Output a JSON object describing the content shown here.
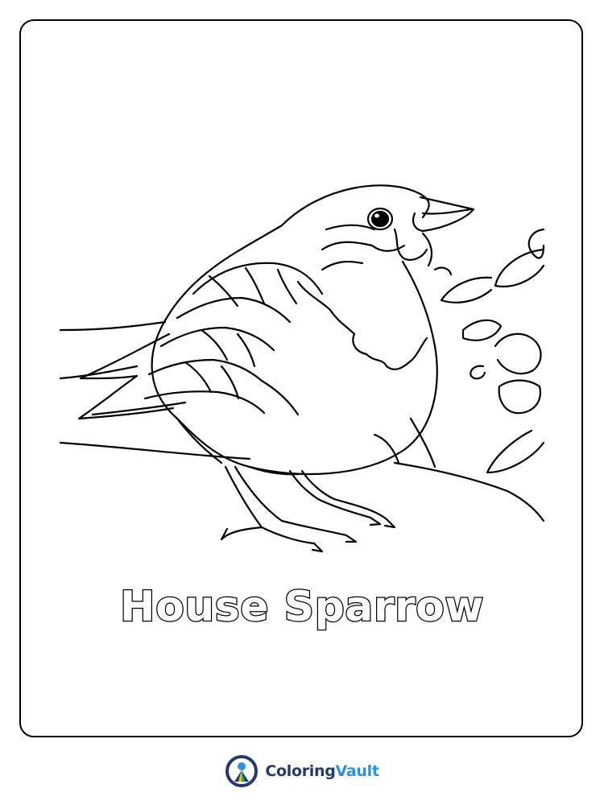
{
  "page": {
    "title": "House Sparrow",
    "subject": "house-sparrow"
  },
  "brand": {
    "name_part1": "Coloring",
    "name_part2": "Vault",
    "logo_icon": "coloring-vault-logo-icon",
    "colors": {
      "navy": "#243a6b",
      "blue": "#2f8fd8",
      "yellow": "#f5c200",
      "green": "#2aa876"
    }
  }
}
